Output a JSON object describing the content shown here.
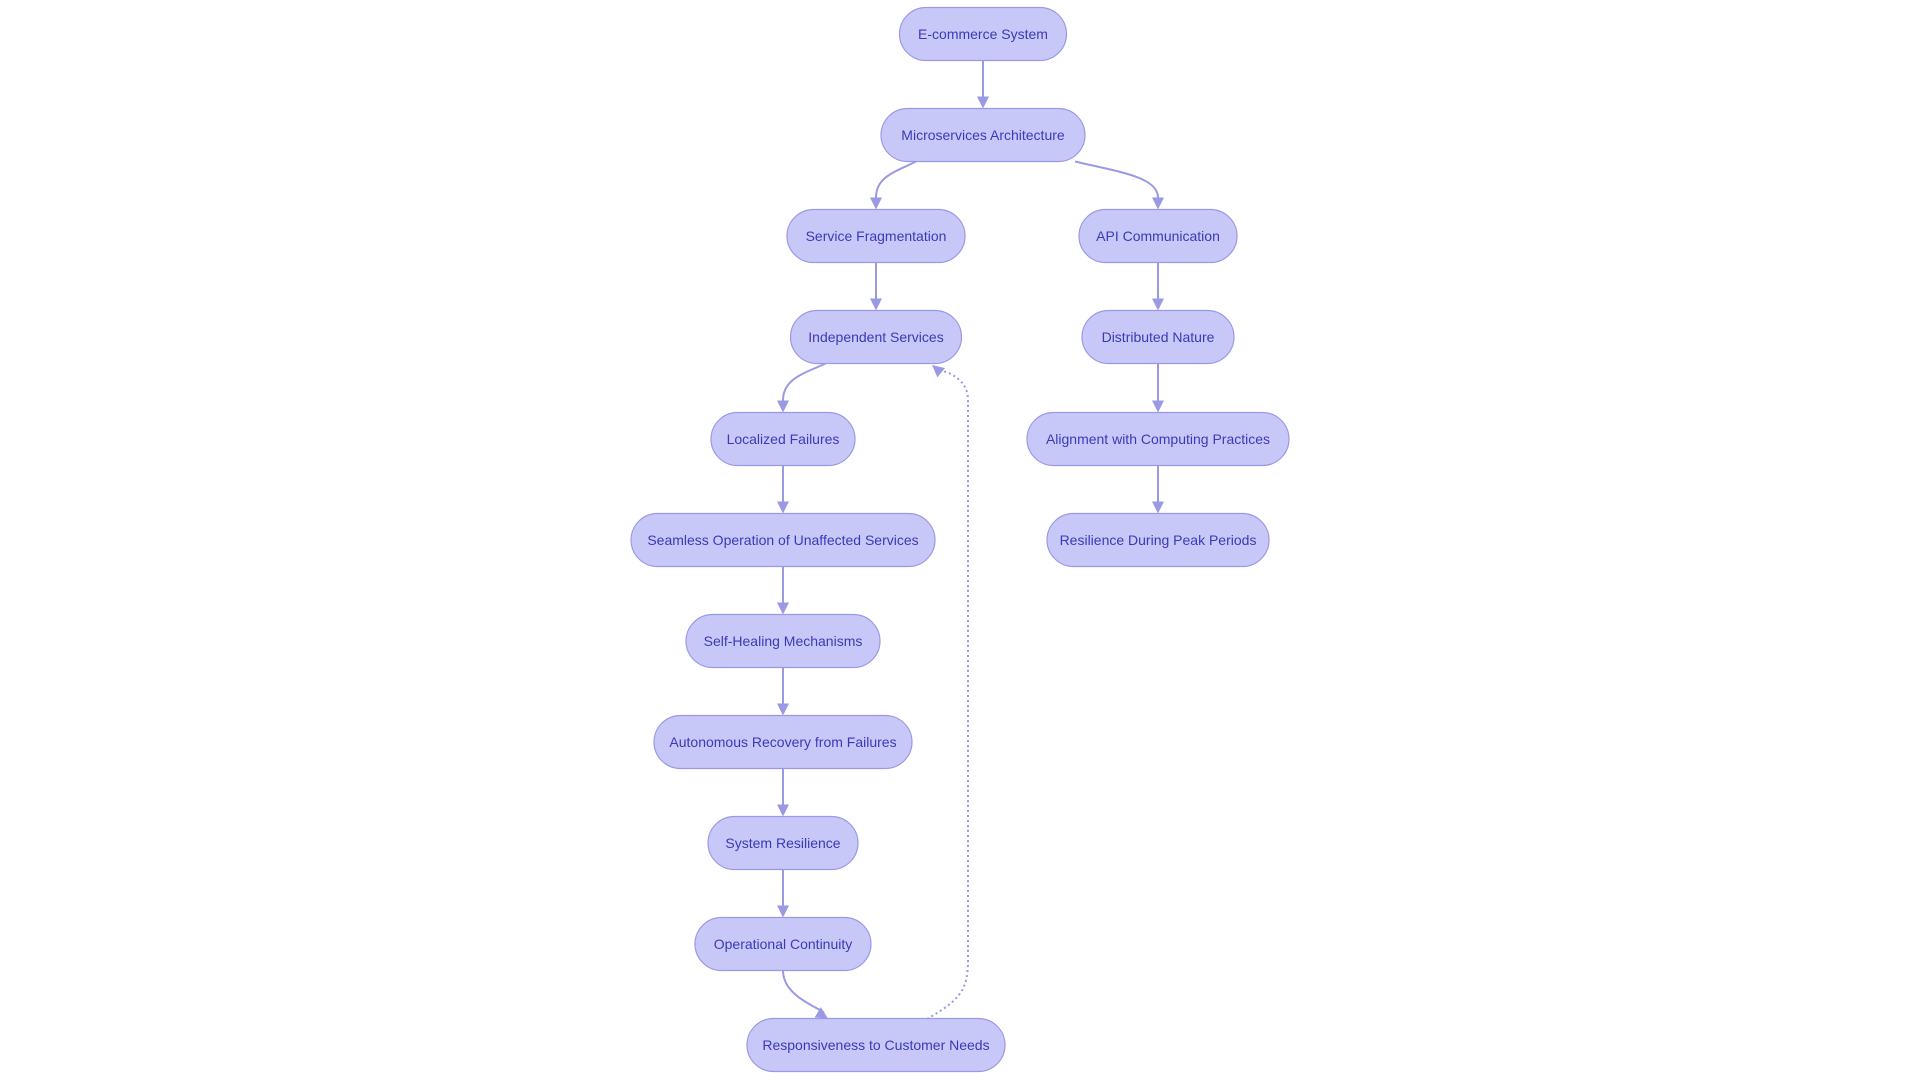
{
  "diagram": {
    "type": "flowchart",
    "direction": "top-down",
    "colors": {
      "node_fill": "#c8c8f8",
      "node_stroke": "#9a9ae4",
      "text": "#3a3ab8",
      "edge": "#9a9ae4",
      "background": "#ffffff"
    },
    "nodes": [
      {
        "id": "A",
        "label": "E-commerce System"
      },
      {
        "id": "B",
        "label": "Microservices Architecture"
      },
      {
        "id": "C",
        "label": "Service Fragmentation"
      },
      {
        "id": "D",
        "label": "API Communication"
      },
      {
        "id": "E",
        "label": "Independent Services"
      },
      {
        "id": "F",
        "label": "Distributed Nature"
      },
      {
        "id": "G",
        "label": "Localized Failures"
      },
      {
        "id": "H",
        "label": "Alignment with Computing Practices"
      },
      {
        "id": "I",
        "label": "Seamless Operation of Unaffected Services"
      },
      {
        "id": "J",
        "label": "Resilience During Peak Periods"
      },
      {
        "id": "K",
        "label": "Self-Healing Mechanisms"
      },
      {
        "id": "L",
        "label": "Autonomous Recovery from Failures"
      },
      {
        "id": "M",
        "label": "System Resilience"
      },
      {
        "id": "N",
        "label": "Operational Continuity"
      },
      {
        "id": "O",
        "label": "Responsiveness to Customer Needs"
      }
    ],
    "edges": [
      {
        "from": "A",
        "to": "B",
        "style": "solid"
      },
      {
        "from": "B",
        "to": "C",
        "style": "solid"
      },
      {
        "from": "B",
        "to": "D",
        "style": "solid"
      },
      {
        "from": "C",
        "to": "E",
        "style": "solid"
      },
      {
        "from": "D",
        "to": "F",
        "style": "solid"
      },
      {
        "from": "E",
        "to": "G",
        "style": "solid"
      },
      {
        "from": "F",
        "to": "H",
        "style": "solid"
      },
      {
        "from": "G",
        "to": "I",
        "style": "solid"
      },
      {
        "from": "H",
        "to": "J",
        "style": "solid"
      },
      {
        "from": "I",
        "to": "K",
        "style": "solid"
      },
      {
        "from": "K",
        "to": "L",
        "style": "solid"
      },
      {
        "from": "L",
        "to": "M",
        "style": "solid"
      },
      {
        "from": "M",
        "to": "N",
        "style": "solid"
      },
      {
        "from": "N",
        "to": "O",
        "style": "solid"
      },
      {
        "from": "O",
        "to": "E",
        "style": "dotted"
      }
    ]
  }
}
